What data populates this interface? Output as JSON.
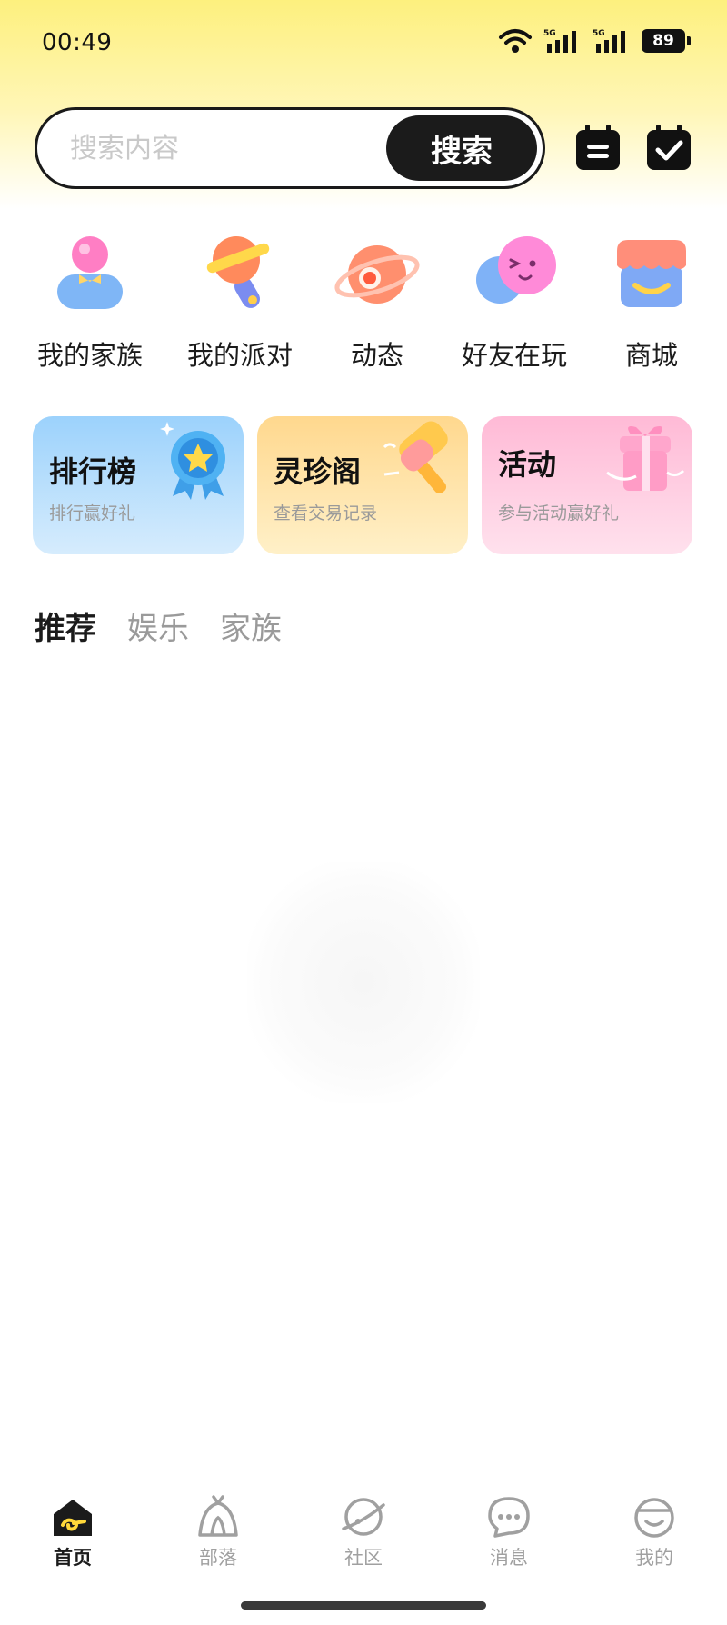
{
  "status_bar": {
    "time": "00:49",
    "network_1": "5G",
    "network_2": "5G",
    "battery": "89"
  },
  "search": {
    "placeholder": "搜索内容",
    "button_label": "搜索"
  },
  "top_icons": [
    "menu-icon",
    "checkin-calendar-icon"
  ],
  "quick_entries": [
    {
      "label": "我的家族",
      "icon": "family-icon"
    },
    {
      "label": "我的派对",
      "icon": "party-microphone-icon"
    },
    {
      "label": "动态",
      "icon": "planet-icon"
    },
    {
      "label": "好友在玩",
      "icon": "friends-icon"
    },
    {
      "label": "商城",
      "icon": "shop-icon"
    }
  ],
  "cards": [
    {
      "title": "排行榜",
      "subtitle": "排行赢好礼",
      "icon": "medal-icon"
    },
    {
      "title": "灵珍阁",
      "subtitle": "查看交易记录",
      "icon": "hammer-icon"
    },
    {
      "title": "活动",
      "subtitle": "参与活动赢好礼",
      "icon": "gift-icon"
    }
  ],
  "tabs": [
    {
      "label": "推荐",
      "active": true
    },
    {
      "label": "娱乐",
      "active": false
    },
    {
      "label": "家族",
      "active": false
    }
  ],
  "bottom_nav": [
    {
      "label": "首页",
      "icon": "home-icon",
      "active": true
    },
    {
      "label": "部落",
      "icon": "tribe-icon",
      "active": false
    },
    {
      "label": "社区",
      "icon": "community-planet-icon",
      "active": false
    },
    {
      "label": "消息",
      "icon": "message-icon",
      "active": false
    },
    {
      "label": "我的",
      "icon": "profile-icon",
      "active": false
    }
  ],
  "colors": {
    "header_yellow": "#fdf07e",
    "dark": "#1b1b1b",
    "muted_text": "#9a9a9a",
    "rank_card": "#9cd2fc",
    "treasure_card": "#ffd88e",
    "activity_card": "#ffbad6"
  }
}
